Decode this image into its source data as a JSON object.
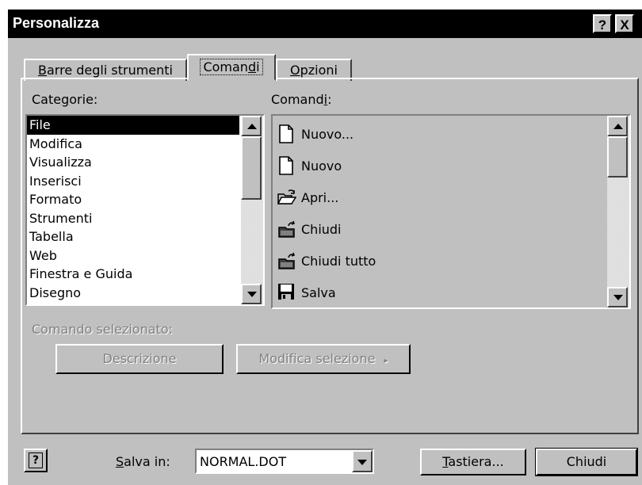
{
  "window": {
    "title": "Personalizza",
    "help_button": "?",
    "close_button": "X"
  },
  "tabs": [
    {
      "label": "Barre degli strumenti",
      "accesskey": "B",
      "selected": false
    },
    {
      "label": "Comandi",
      "accesskey": "d",
      "selected": true
    },
    {
      "label": "Opzioni",
      "accesskey": "O",
      "selected": false
    }
  ],
  "categories": {
    "label": "Categorie:",
    "items": [
      "File",
      "Modifica",
      "Visualizza",
      "Inserisci",
      "Formato",
      "Strumenti",
      "Tabella",
      "Web",
      "Finestra e Guida",
      "Disegno"
    ],
    "selected": "File"
  },
  "commands": {
    "label": "Comandi:",
    "items": [
      {
        "label": "Nuovo...",
        "icon": "new-document-icon"
      },
      {
        "label": "Nuovo",
        "icon": "new-document-icon"
      },
      {
        "label": "Apri...",
        "icon": "open-folder-icon"
      },
      {
        "label": "Chiudi",
        "icon": "close-folder-icon"
      },
      {
        "label": "Chiudi tutto",
        "icon": "close-folder-icon"
      },
      {
        "label": "Salva",
        "icon": "save-disk-icon"
      }
    ]
  },
  "selected_command": {
    "label": "Comando selezionato:",
    "description_button": "Descrizione",
    "modify_button": "Modifica selezione"
  },
  "footer": {
    "help_icon": "question-mark-icon",
    "save_in_label": "Salva in:",
    "save_in_value": "NORMAL.DOT",
    "keyboard_button": "Tastiera...",
    "close_button": "Chiudi"
  },
  "colors": {
    "titlebar": "#000000",
    "face": "#c0c0c0",
    "selection": "#000000"
  }
}
